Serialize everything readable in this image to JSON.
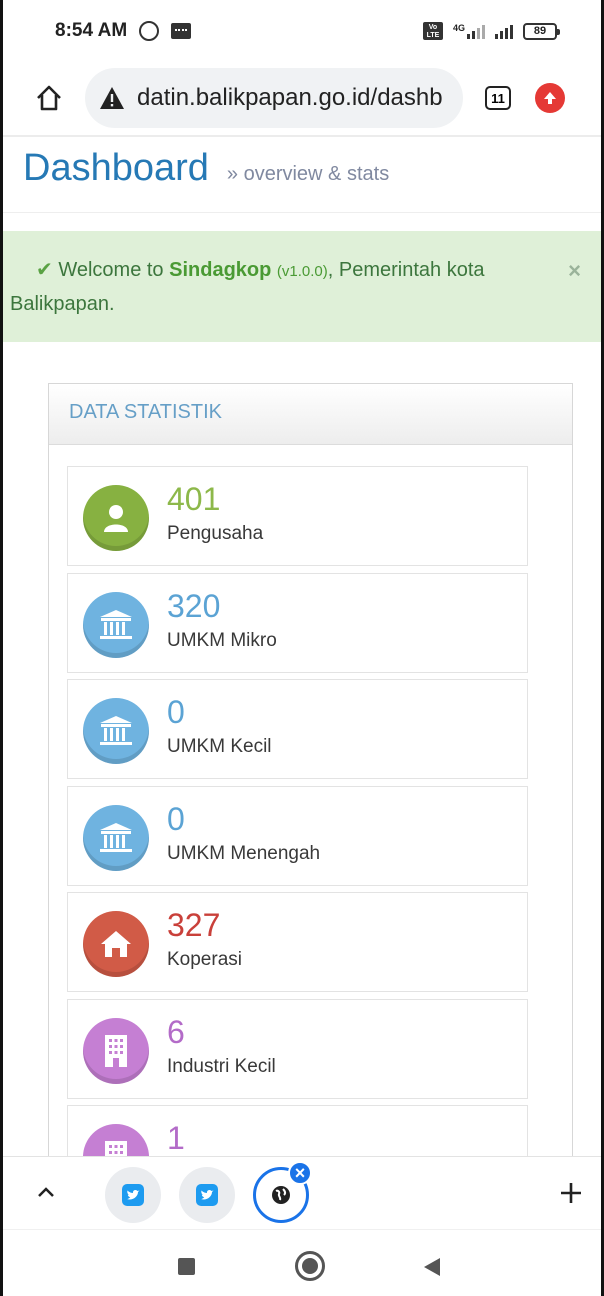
{
  "status_bar": {
    "time": "8:54 AM",
    "network": "4G",
    "volte": "Vo LTE",
    "battery": "89"
  },
  "browser": {
    "url": "datin.balikpapan.go.id/dashb",
    "tab_count": "11"
  },
  "page": {
    "title": "Dashboard",
    "subtitle": "» overview & stats"
  },
  "alert": {
    "check": "✔",
    "prefix": "Welcome to",
    "app": "Sindagkop",
    "version": "(v1.0.0)",
    "suffix": ", Pemerintah kota Balikpapan.",
    "close": "×"
  },
  "widget": {
    "title": "DATA STATISTIK",
    "stats": [
      {
        "value": "401",
        "label": "Pengusaha",
        "icon": "user-icon",
        "color": "#87b141",
        "value_color": "#8db84a"
      },
      {
        "value": "320",
        "label": "UMKM Mikro",
        "icon": "bank-icon",
        "color": "#6fb3e0",
        "value_color": "#5ba3d4"
      },
      {
        "value": "0",
        "label": "UMKM Kecil",
        "icon": "bank-icon",
        "color": "#6fb3e0",
        "value_color": "#5ba3d4"
      },
      {
        "value": "0",
        "label": "UMKM Menengah",
        "icon": "bank-icon",
        "color": "#6fb3e0",
        "value_color": "#5ba3d4"
      },
      {
        "value": "327",
        "label": "Koperasi",
        "icon": "home-icon",
        "color": "#d15b47",
        "value_color": "#c9403a"
      },
      {
        "value": "6",
        "label": "Industri Kecil",
        "icon": "building-icon",
        "color": "#c57fd3",
        "value_color": "#b36bc8"
      },
      {
        "value": "1",
        "label": "",
        "icon": "building-icon",
        "color": "#c57fd3",
        "value_color": "#b36bc8"
      }
    ]
  },
  "toolbar": {
    "plus": "+",
    "close_badge": "×"
  },
  "colors": {
    "accent": "#2679b5",
    "alert_bg": "#dff0d8",
    "chrome_blue": "#1a73e8"
  }
}
